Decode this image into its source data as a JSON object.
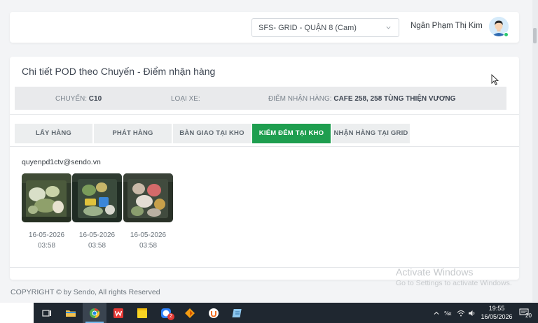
{
  "header": {
    "location_select": "SFS- GRID - QUẬN 8 (Cam)",
    "user_name": "Ngân Phạm Thị Kim"
  },
  "card": {
    "title": "Chi tiết POD theo Chuyến - Điểm nhận hàng",
    "info": {
      "trip_label": "CHUYẾN:",
      "trip_value": "C10",
      "vehicle_label": "LOẠI XE:",
      "vehicle_value": "",
      "pickup_label": "ĐIỂM NHẬN HÀNG:",
      "pickup_value": "CAFE 258, 258 TÙNG THIỆN VƯƠNG"
    },
    "tabs": [
      {
        "label": "LẤY HÀNG",
        "active": false
      },
      {
        "label": "PHÁT HÀNG",
        "active": false
      },
      {
        "label": "BÀN GIAO TẠI KHO",
        "active": false
      },
      {
        "label": "KIỂM ĐẾM TẠI KHO",
        "active": true
      },
      {
        "label": "NHẬN HÀNG TẠI GRID",
        "active": false
      }
    ],
    "uploader_email": "quyenpd1ctv@sendo.vn",
    "photos": [
      {
        "date": "16-05-2026",
        "time": "03:58"
      },
      {
        "date": "16-05-2026",
        "time": "03:58"
      },
      {
        "date": "16-05-2026",
        "time": "03:58"
      }
    ]
  },
  "footer": {
    "copyright": "COPYRIGHT © by Sendo, All rights Reserved"
  },
  "watermark": {
    "line1": "Activate Windows",
    "line2": "Go to Settings to activate Windows."
  },
  "taskbar": {
    "time": "19:55",
    "date": "16/05/2026",
    "notification_count": "20",
    "badge_count": "2",
    "ime_indicator": "ENG"
  },
  "colors": {
    "accent_green": "#1e9e4f",
    "page_bg": "#f3f4f6",
    "info_bar_bg": "#e9eaec"
  }
}
